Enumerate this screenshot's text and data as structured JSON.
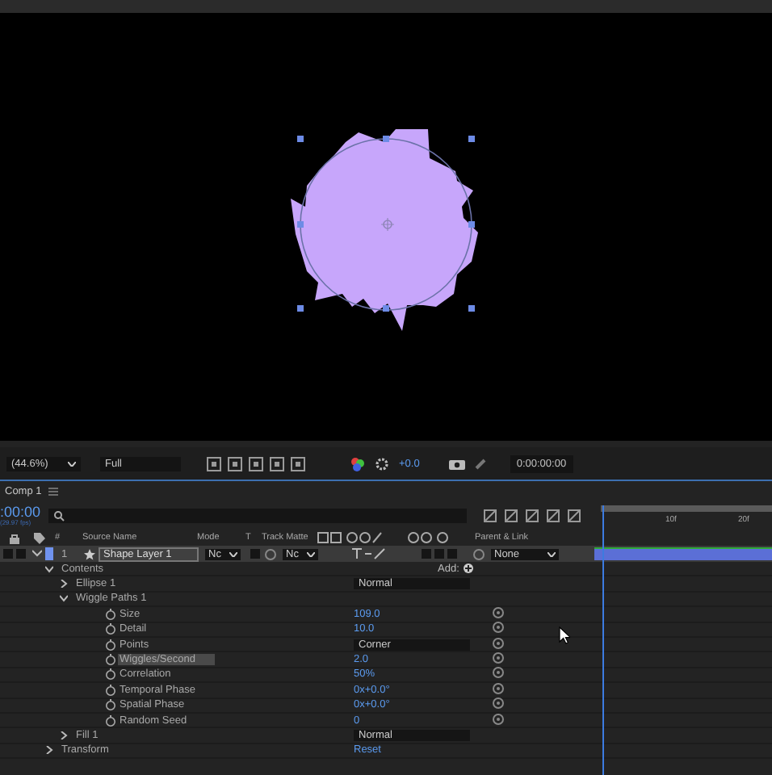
{
  "viewer_toolbar": {
    "zoom": "(44.6%)",
    "resolution": "Full",
    "exposure": "+0.0",
    "timecode": "0:00:00:00"
  },
  "comp_tab": {
    "label": "Comp 1"
  },
  "timeline": {
    "current_time": ":00:00",
    "frame_rate": "(29.97 fps)",
    "ruler_labels": [
      "10f",
      "20f"
    ]
  },
  "columns": [
    "#",
    "Source Name",
    "Mode",
    "T",
    "Track Matte",
    "Parent & Link"
  ],
  "layer": {
    "number": "1",
    "name": "Shape Layer 1",
    "mode": "Nc",
    "track_matte": "Nc",
    "parent": "None",
    "expanded": true
  },
  "properties": [
    {
      "kind": "group",
      "name": "Contents",
      "expanded": true,
      "selected": false,
      "add_label": "Add:",
      "children": [
        {
          "kind": "group",
          "name": "Ellipse 1",
          "expanded": false,
          "selected": false,
          "blend_mode": "Normal"
        },
        {
          "kind": "group",
          "name": "Wiggle Paths 1",
          "expanded": true,
          "selected": false,
          "children": [
            {
              "kind": "number",
              "name": "Size",
              "value": "109.0",
              "selected": false
            },
            {
              "kind": "number",
              "name": "Detail",
              "value": "10.0",
              "selected": false
            },
            {
              "kind": "dropdown",
              "name": "Points",
              "value": "Corner",
              "selected": false
            },
            {
              "kind": "number",
              "name": "Wiggles/Second",
              "value": "2.0",
              "selected": true
            },
            {
              "kind": "number",
              "name": "Correlation",
              "value": "50%",
              "selected": false
            },
            {
              "kind": "number",
              "name": "Temporal Phase",
              "value": "0x+0.0°",
              "selected": false
            },
            {
              "kind": "number",
              "name": "Spatial Phase",
              "value": "0x+0.0°",
              "selected": false
            },
            {
              "kind": "number",
              "name": "Random Seed",
              "value": "0",
              "selected": false
            }
          ]
        },
        {
          "kind": "group",
          "name": "Fill 1",
          "expanded": false,
          "selected": false,
          "blend_mode": "Normal"
        }
      ]
    },
    {
      "kind": "group",
      "name": "Transform",
      "expanded": false,
      "selected": false,
      "link": "Reset"
    }
  ]
}
